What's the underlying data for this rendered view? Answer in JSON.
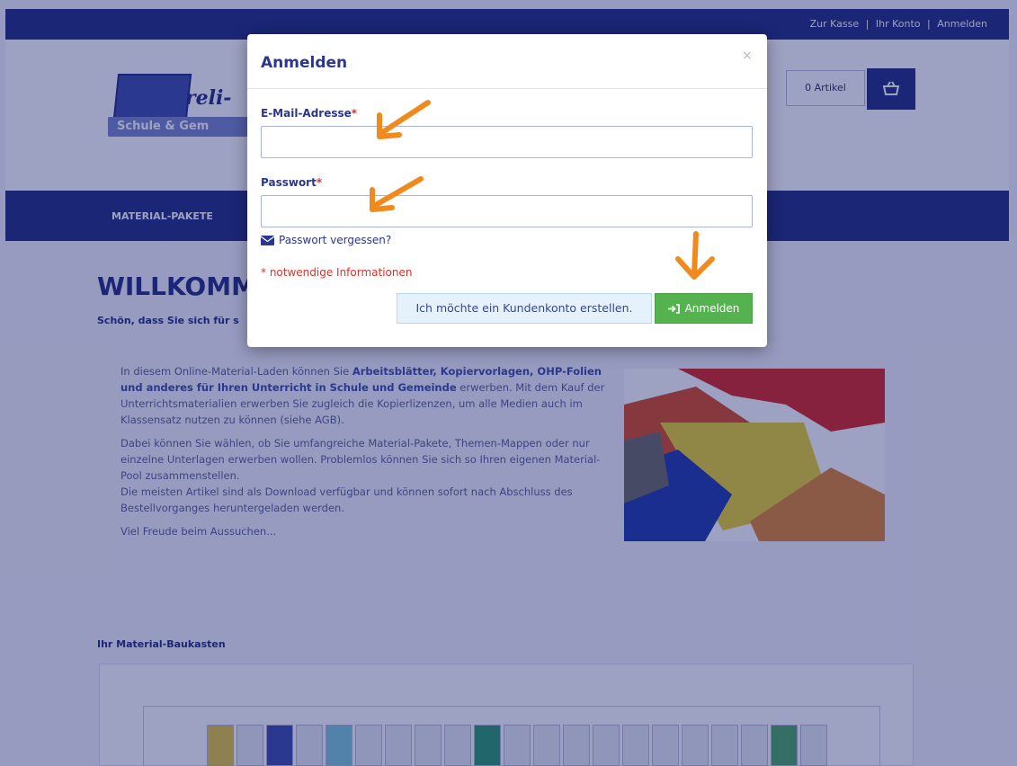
{
  "topbar": {
    "links": [
      "Zur Kasse",
      "Ihr Konto",
      "Anmelden"
    ],
    "separator": "|"
  },
  "header": {
    "logo_text": "reli-",
    "logo_band": "Schule & Gem",
    "cart_count": "0 Artikel"
  },
  "nav": {
    "items": [
      "MATERIAL-PAKETE"
    ]
  },
  "welcome": {
    "title": "WILLKOMME",
    "tagline": "Schön, dass Sie sich für s"
  },
  "intro": {
    "p1_lead": "In diesem Online-Material-Laden können Sie ",
    "p1_bold": "Arbeitsblätter, Kopiervorlagen, OHP-Folien und anderes für Ihren Unterricht in Schule und Gemeinde",
    "p1_tail": " erwerben. Mit dem Kauf der Unterrichtsmaterialien erwerben Sie zugleich die Kopierlizenzen, um alle Medien auch im Klassensatz nutzen zu können (siehe AGB).",
    "p2": "Dabei können Sie wählen, ob Sie umfangreiche Material-Pakete, Themen-Mappen oder nur einzelne Unterlagen erwerben wollen. Problemlos können Sie sich so Ihren eigenen Material-Pool zusammenstellen.",
    "p3": "Die meisten Artikel sind als Download verfügbar und können sofort nach Abschluss des Bestellvorganges heruntergeladen werden.",
    "p4": "Viel Freude beim Aussuchen..."
  },
  "baukasten": {
    "title": "Ihr Material-Baukasten"
  },
  "modal": {
    "title": "Anmelden",
    "close": "×",
    "email_label": "E-Mail-Adresse",
    "password_label": "Passwort",
    "required_mark": "*",
    "email_value": "",
    "password_value": "",
    "forgot_link": "Passwort vergessen?",
    "required_note": "* notwendige Informationen",
    "register_button": "Ich möchte ein Kundenkonto erstellen.",
    "login_button": "Anmelden"
  },
  "icons": {
    "cart": "shopping-basket-icon",
    "forgot": "envelope-icon",
    "login": "sign-in-icon",
    "close": "close-icon"
  },
  "colors": {
    "brand_navy": "#1f2c7c",
    "modal_title": "#2b3690",
    "required_red": "#d8332b",
    "login_green": "#54b24f",
    "register_bg": "#e6f2fb",
    "annotation_orange": "#f08a1c"
  }
}
